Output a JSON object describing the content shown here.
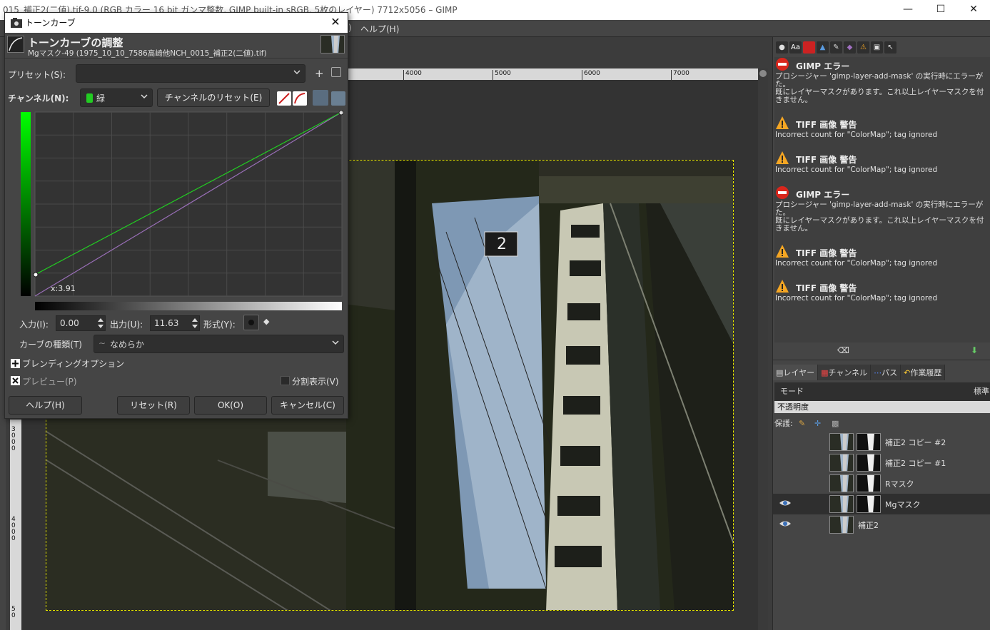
{
  "window": {
    "title": "015_補正2(二値).tif-9.0 (RGB カラー 16 bit ガンマ整数, GIMP built-in sRGB, 5枚のレイヤー) 7712x5056 – GIMP",
    "minimize": "—",
    "maximize": "",
    "close": ""
  },
  "menubar": {
    "partial": ")",
    "help": "ヘルプ(H)"
  },
  "ruler": {
    "h_ticks": [
      "4000",
      "5000",
      "6000",
      "7000"
    ],
    "v_ticks_1": [
      "3",
      "0",
      "0",
      "0"
    ],
    "v_ticks_2": [
      "4",
      "0",
      "0",
      "0"
    ],
    "v_ticks_3": [
      "5",
      "0"
    ]
  },
  "dialog": {
    "title": "トーンカーブ",
    "heading": "トーンカーブの調整",
    "subheading": "Mgマスク-49 (1975_10_10_7586高崎他NCH_0015_補正2(二値).tif)",
    "preset_label": "プリセット(S):",
    "preset_value": "",
    "preset_add": "+",
    "channel_label": "チャンネル(N):",
    "channel_value": "緑",
    "channel_reset": "チャンネルのリセット(E)",
    "graph_readout": "x:3.91",
    "input_label": "入力(I):",
    "input_value": "0.00",
    "output_label": "出力(U):",
    "output_value": "11.63",
    "type_label": "形式(Y):",
    "curve_type_label": "カーブの種類(T)",
    "curve_type_value": "なめらか",
    "blending_label": "ブレンディングオプション",
    "preview_label": "プレビュー(P)",
    "split_label": "分割表示(V)",
    "help_btn": "ヘルプ(H)",
    "reset_btn": "リセット(R)",
    "ok_btn": "OK(O)",
    "cancel_btn": "キャンセル(C)"
  },
  "curve": {
    "green_start": 11.63,
    "green_end": 100,
    "diagonal_start": 0,
    "diagonal_end": 100,
    "green_color": "#22cc22",
    "diagonal_color": "#9a6fb8"
  },
  "messages": [
    {
      "type": "error",
      "title": "GIMP エラー",
      "body": "プロシージャー 'gimp-layer-add-mask' の実行時にエラーが\nた。\n既にレイヤーマスクがあります。これ以上レイヤーマスクを付\nきません。"
    },
    {
      "type": "warning",
      "title": "TIFF 画像 警告",
      "body": "Incorrect count for \"ColorMap\"; tag ignored"
    },
    {
      "type": "warning",
      "title": "TIFF 画像 警告",
      "body": "Incorrect count for \"ColorMap\"; tag ignored"
    },
    {
      "type": "error",
      "title": "GIMP エラー",
      "body": "プロシージャー 'gimp-layer-add-mask' の実行時にエラーが\nた。\n既にレイヤーマスクがあります。これ以上レイヤーマスクを付\nきません。"
    },
    {
      "type": "warning",
      "title": "TIFF 画像 警告",
      "body": "Incorrect count for \"ColorMap\"; tag ignored"
    },
    {
      "type": "warning",
      "title": "TIFF 画像 警告",
      "body": "Incorrect count for \"ColorMap\"; tag ignored"
    }
  ],
  "layers_panel": {
    "tabs": [
      "レイヤー",
      "チャンネル",
      "パス",
      "作業履歴"
    ],
    "mode_label": "モード",
    "mode_value": "標準",
    "opacity_label": "不透明度",
    "protect_label": "保護:",
    "layers": [
      {
        "name": "補正2 コピー #2",
        "visible": false,
        "mask": true,
        "selected": false
      },
      {
        "name": "補正2 コピー #1",
        "visible": false,
        "mask": true,
        "selected": false
      },
      {
        "name": "Rマスク",
        "visible": false,
        "mask": true,
        "selected": false
      },
      {
        "name": "Mgマスク",
        "visible": true,
        "mask": true,
        "selected": true
      },
      {
        "name": "補正2",
        "visible": true,
        "mask": false,
        "selected": false
      }
    ]
  }
}
